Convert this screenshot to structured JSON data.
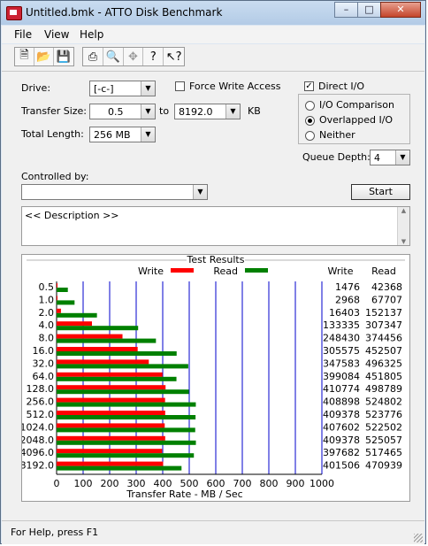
{
  "window": {
    "title": "Untitled.bmk - ATTO Disk Benchmark"
  },
  "menu": [
    "File",
    "View",
    "Help"
  ],
  "toolbar": {
    "icons": [
      "new-file-icon",
      "open-folder-icon",
      "save-icon",
      "print-icon",
      "print-preview-icon",
      "move-icon",
      "help-icon",
      "context-help-icon"
    ]
  },
  "settings": {
    "drive_label": "Drive:",
    "drive_value": "[-c-]",
    "force_write_label": "Force Write Access",
    "direct_io_label": "Direct I/O",
    "direct_io_checked": true,
    "transfer_size_label": "Transfer Size:",
    "transfer_from": "0.5",
    "to_label": "to",
    "transfer_to": "8192.0",
    "kb_label": "KB",
    "total_length_label": "Total Length:",
    "total_length_value": "256 MB",
    "radio_io_comparison": "I/O Comparison",
    "radio_overlapped": "Overlapped I/O",
    "radio_neither": "Neither",
    "queue_depth_label": "Queue Depth:",
    "queue_depth_value": "4",
    "controlled_by_label": "Controlled by:",
    "start_label": "Start",
    "description": "<< Description >>"
  },
  "results": {
    "title": "Test Results",
    "legend_write": "Write",
    "legend_read": "Read",
    "col_write": "Write",
    "col_read": "Read",
    "write_color": "#ff0000",
    "read_color": "#008000"
  },
  "chart_data": {
    "type": "bar",
    "categories": [
      "0.5",
      "1.0",
      "2.0",
      "4.0",
      "8.0",
      "16.0",
      "32.0",
      "64.0",
      "128.0",
      "256.0",
      "512.0",
      "1024.0",
      "2048.0",
      "4096.0",
      "8192.0"
    ],
    "series": [
      {
        "name": "Write",
        "values": [
          1476,
          2968,
          16403,
          133335,
          248430,
          305575,
          347583,
          399084,
          410774,
          408898,
          409378,
          407602,
          409378,
          397682,
          401506
        ]
      },
      {
        "name": "Read",
        "values": [
          42368,
          67707,
          152137,
          307347,
          374456,
          452507,
          496325,
          451805,
          498789,
          524802,
          523776,
          522502,
          525057,
          517465,
          470939
        ]
      }
    ],
    "xlabel": "Transfer Rate - MB / Sec",
    "xticks": [
      "0",
      "100",
      "200",
      "300",
      "400",
      "500",
      "600",
      "700",
      "800",
      "900",
      "1000"
    ],
    "xlim": [
      0,
      1000
    ]
  },
  "status": {
    "text": "For Help, press F1"
  }
}
